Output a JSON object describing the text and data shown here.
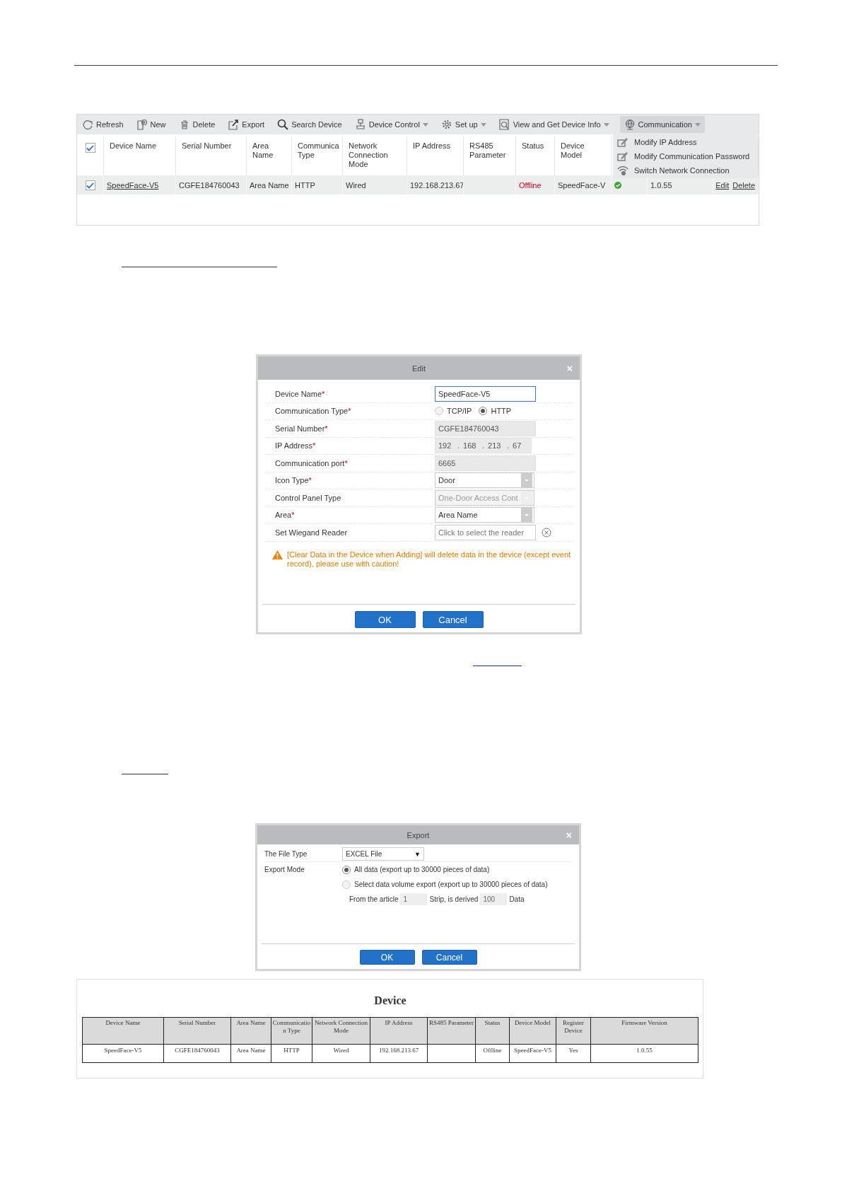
{
  "device_list": {
    "toolbar": [
      {
        "label": "Refresh",
        "dropdown": false,
        "selected": false
      },
      {
        "label": "New",
        "dropdown": false,
        "selected": false
      },
      {
        "label": "Delete",
        "dropdown": false,
        "selected": false
      },
      {
        "label": "Export",
        "dropdown": false,
        "selected": false
      },
      {
        "label": "Search Device",
        "dropdown": false,
        "selected": false
      },
      {
        "label": "Device Control",
        "dropdown": true,
        "selected": false
      },
      {
        "label": "Set up",
        "dropdown": true,
        "selected": false
      },
      {
        "label": "View and Get Device Info",
        "dropdown": true,
        "selected": false
      },
      {
        "label": "Communication",
        "dropdown": true,
        "selected": true
      }
    ],
    "header_checked": true,
    "columns": [
      "Device Name",
      "Serial Number",
      "Area Name",
      "Communica Type",
      "Network Connection Mode",
      "IP Address",
      "RS485 Parameter",
      "Status",
      "Device Model"
    ],
    "rows": [
      {
        "checked": true,
        "device_name": "SpeedFace-V5",
        "serial_number": "CGFE184760043",
        "area_name": "Area Name",
        "communication_type": "HTTP",
        "network_connection_mode": "Wired",
        "ip_address": "192.168.213.67",
        "status": "Offline",
        "online": false,
        "device_model": "SpeedFace-V",
        "enabled": true,
        "column_12": "1.0.55",
        "actions": [
          "Edit",
          "Delete"
        ]
      }
    ],
    "menu": [
      "Modify IP Address",
      "Modify Communication Password",
      "Switch Network Connection"
    ]
  },
  "edit_dialog": {
    "title": "Edit",
    "close": "×",
    "fields": [
      {
        "kind": "text",
        "label": "Device Name",
        "asterisk": "*",
        "value": "SpeedFace-V5"
      },
      {
        "kind": "radio",
        "label": "Communication Type",
        "asterisk": "*",
        "options": [
          {
            "label": "TCP/IP",
            "selected": false
          },
          {
            "label": "HTTP",
            "selected": true
          }
        ]
      },
      {
        "kind": "readonly",
        "label": "Serial Number",
        "asterisk": "*",
        "value": "CGFE184760043"
      },
      {
        "kind": "ip",
        "label": "IP Address",
        "asterisk": "*",
        "octets": [
          "192",
          "168",
          "213",
          "67"
        ],
        "separators": [
          ".",
          ".",
          "."
        ]
      },
      {
        "kind": "readonly",
        "label": "Communication port",
        "asterisk": "*",
        "value": "6665"
      },
      {
        "kind": "select",
        "label": "Icon Type",
        "asterisk": "*",
        "value": "Door",
        "disabled": false
      },
      {
        "kind": "select",
        "label": "Control Panel Type",
        "value": "One-Door Access Cont",
        "disabled": true
      },
      {
        "kind": "select",
        "label": "Area",
        "asterisk": "*",
        "value": "Area Name",
        "disabled": false
      },
      {
        "kind": "picker",
        "label": "Set Wiegand Reader",
        "placeholder": "Click to select the reader"
      }
    ],
    "warning": "[Clear Data in the Device when Adding] will delete data in the device (except event record), please use with caution!",
    "buttons": [
      "OK",
      "Cancel"
    ]
  },
  "export_dialog": {
    "title": "Export",
    "close": "×",
    "file_type": {
      "label": "The File Type",
      "value": "EXCEL File",
      "caret": "▼"
    },
    "export_mode": {
      "label": "Export Mode",
      "options": [
        {
          "label": "All data (export up to 30000 pieces of data)",
          "selected": true
        },
        {
          "label": "Select data volume export (export up to 30000 pieces of data)",
          "selected": false
        }
      ]
    },
    "range": {
      "from_label": "From the article",
      "from_value": "1",
      "middle_label": "Strip, is derived",
      "count_value": "100",
      "end_label": "Data"
    },
    "buttons": [
      "OK",
      "Cancel"
    ]
  },
  "report": {
    "title": "Device",
    "columns": [
      "Device Name",
      "Serial Number",
      "Area Name",
      "Communication Type",
      "Network Connection Mode",
      "IP Address",
      "RS485 Parameter",
      "Status",
      "Device Model",
      "Register Device",
      "Firmware Version"
    ],
    "rows": [
      [
        "SpeedFace-V5",
        "CGFE184760043",
        "Area Name",
        "HTTP",
        "Wired",
        "192.168.213.67",
        null,
        "Offline",
        "SpeedFace-V5",
        "Yes",
        "1.0.55"
      ]
    ]
  }
}
